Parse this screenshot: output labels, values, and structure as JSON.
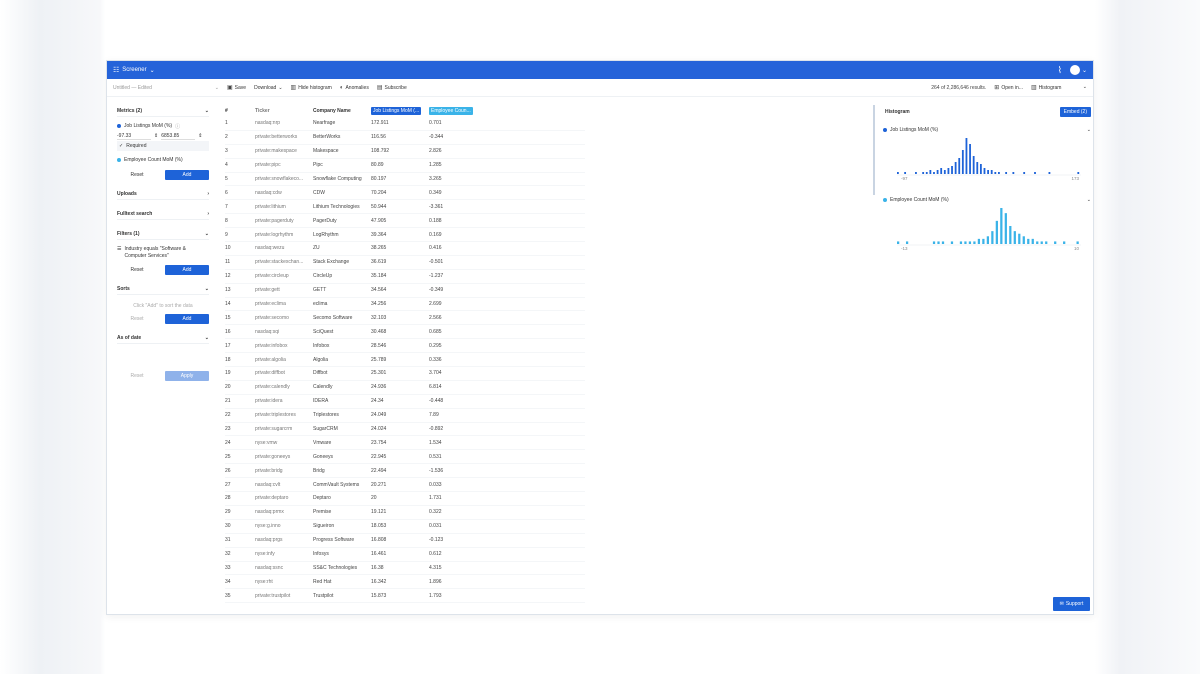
{
  "header": {
    "brand": "Screener",
    "colors": {
      "topbar": "#2563d9",
      "accent": "#1e63d8",
      "series1": "#1e63d8",
      "series2": "#3ab3e8"
    }
  },
  "toolbar": {
    "title": "Untitled — Edited",
    "save": "Save",
    "download": "Download",
    "hide_histogram": "Hide histogram",
    "anomalies": "Anomalies",
    "subscribe": "Subscribe",
    "results": "264 of 2,286,646 results.",
    "open_in": "Open in...",
    "view": "Histogram"
  },
  "sidebar": {
    "metrics_title": "Metrics (2)",
    "metric1": "Job Listings MoM (%)",
    "range_min": "-97.33",
    "range_max": "6853.85",
    "required": "Required",
    "metric2": "Employee Count MoM (%)",
    "reset": "Reset",
    "add": "Add",
    "uploads": "Uploads",
    "fulltext": "Fulltext search",
    "filters_title": "Filters (1)",
    "filter1": "Industry equals \"Software & Computer Services\"",
    "sorts": "Sorts",
    "sorts_hint": "Click \"Add\" to sort the data",
    "as_of": "As of date",
    "apply": "Apply"
  },
  "table": {
    "headers": {
      "num": "#",
      "ticker": "Ticker",
      "company": "Company Name",
      "m1": "Job Listings MoM (...",
      "m2": "Employee Coun..."
    },
    "rows": [
      [
        "1",
        "nasdaq:nrp",
        "Nearfrage",
        "172.911",
        "0.701"
      ],
      [
        "2",
        "private:betterworks",
        "BetterWorks",
        "116.56",
        "-0.344"
      ],
      [
        "3",
        "private:makespace",
        "Makespace",
        "108.792",
        "2.826"
      ],
      [
        "4",
        "private:pipc",
        "Pipc",
        "80.89",
        "1.285"
      ],
      [
        "5",
        "private:snowflakeco...",
        "Snowflake Computing",
        "80.197",
        "3.265"
      ],
      [
        "6",
        "nasdaq:cdw",
        "CDW",
        "70.204",
        "0.349"
      ],
      [
        "7",
        "private:lithium",
        "Lithium Technologies",
        "50.944",
        "-3.361"
      ],
      [
        "8",
        "private:pagerduty",
        "PagerDuty",
        "47.905",
        "0.188"
      ],
      [
        "9",
        "private:logrhythm",
        "LogRhythm",
        "39.364",
        "0.169"
      ],
      [
        "10",
        "nasdaq:wezu",
        "ZU",
        "38.265",
        "0.416"
      ],
      [
        "11",
        "private:stackexchan...",
        "Stack Exchange",
        "36.619",
        "-0.501"
      ],
      [
        "12",
        "private:circleup",
        "CircleUp",
        "35.184",
        "-1.237"
      ],
      [
        "13",
        "private:gett",
        "GETT",
        "34.564",
        "-0.349"
      ],
      [
        "14",
        "private:eclima",
        "eclima",
        "34.256",
        "2.699"
      ],
      [
        "15",
        "private:secomo",
        "Secomo Software",
        "32.103",
        "2.566"
      ],
      [
        "16",
        "nasdaq:sqi",
        "SciQuest",
        "30.468",
        "0.685"
      ],
      [
        "17",
        "private:infobox",
        "Infobox",
        "28.546",
        "0.295"
      ],
      [
        "18",
        "private:algolia",
        "Algolia",
        "25.789",
        "0.336"
      ],
      [
        "19",
        "private:diffbot",
        "Diffbot",
        "25.301",
        "3.704"
      ],
      [
        "20",
        "private:calendly",
        "Calendly",
        "24.936",
        "6.814"
      ],
      [
        "21",
        "private:idera",
        "IDERA",
        "24.34",
        "-0.448"
      ],
      [
        "22",
        "private:triplestores",
        "Triplestores",
        "24.049",
        "7.89"
      ],
      [
        "23",
        "private:sugarcrm",
        "SugarCRM",
        "24.024",
        "-0.892"
      ],
      [
        "24",
        "nyse:vmw",
        "Vmware",
        "23.754",
        "1.534"
      ],
      [
        "25",
        "private:goneeys",
        "Goneeys",
        "22.945",
        "0.531"
      ],
      [
        "26",
        "private:bridg",
        "Bridg",
        "22.494",
        "-1.536"
      ],
      [
        "27",
        "nasdaq:cvlt",
        "CommVault Systems",
        "20.271",
        "0.033"
      ],
      [
        "28",
        "private:deptaro",
        "Deptaro",
        "20",
        "1.731"
      ],
      [
        "29",
        "nasdaq:prmx",
        "Premise",
        "19.121",
        "0.322"
      ],
      [
        "30",
        "nyse:g.inno",
        "Sigueiron",
        "18.053",
        "0.031"
      ],
      [
        "31",
        "nasdaq:prgs",
        "Progress Software",
        "16.808",
        "-0.123"
      ],
      [
        "32",
        "nyse:infy",
        "Infosys",
        "16.461",
        "0.612"
      ],
      [
        "33",
        "nasdaq:ssnc",
        "SS&C Technologies",
        "16.38",
        "4.315"
      ],
      [
        "34",
        "nyse:rht",
        "Red Hat",
        "16.342",
        "1.896"
      ],
      [
        "35",
        "private:trustpilot",
        "Trustpilot",
        "15.873",
        "1.793"
      ]
    ]
  },
  "histogram": {
    "title": "Histogram",
    "embed": "Embed (2)",
    "support": "Support"
  },
  "chart_data": [
    {
      "type": "bar",
      "title": "Job Listings MoM (%)",
      "xlim_labels": [
        "-97",
        "173"
      ],
      "values": [
        1,
        0,
        1,
        0,
        0,
        1,
        0,
        1,
        1,
        2,
        1,
        2,
        3,
        2,
        3,
        4,
        6,
        8,
        12,
        18,
        15,
        9,
        6,
        5,
        3,
        2,
        2,
        1,
        1,
        0,
        1,
        0,
        1,
        0,
        0,
        1,
        0,
        0,
        1,
        0,
        0,
        0,
        1,
        0,
        0,
        0,
        0,
        0,
        0,
        0,
        1
      ]
    },
    {
      "type": "bar",
      "title": "Employee Count MoM (%)",
      "xlim_labels": [
        "-13",
        "10"
      ],
      "values": [
        1,
        0,
        1,
        0,
        0,
        0,
        0,
        0,
        1,
        1,
        1,
        0,
        1,
        0,
        1,
        1,
        1,
        1,
        2,
        2,
        3,
        5,
        9,
        14,
        12,
        7,
        5,
        4,
        3,
        2,
        2,
        1,
        1,
        1,
        0,
        1,
        0,
        1,
        0,
        0,
        1
      ]
    }
  ]
}
